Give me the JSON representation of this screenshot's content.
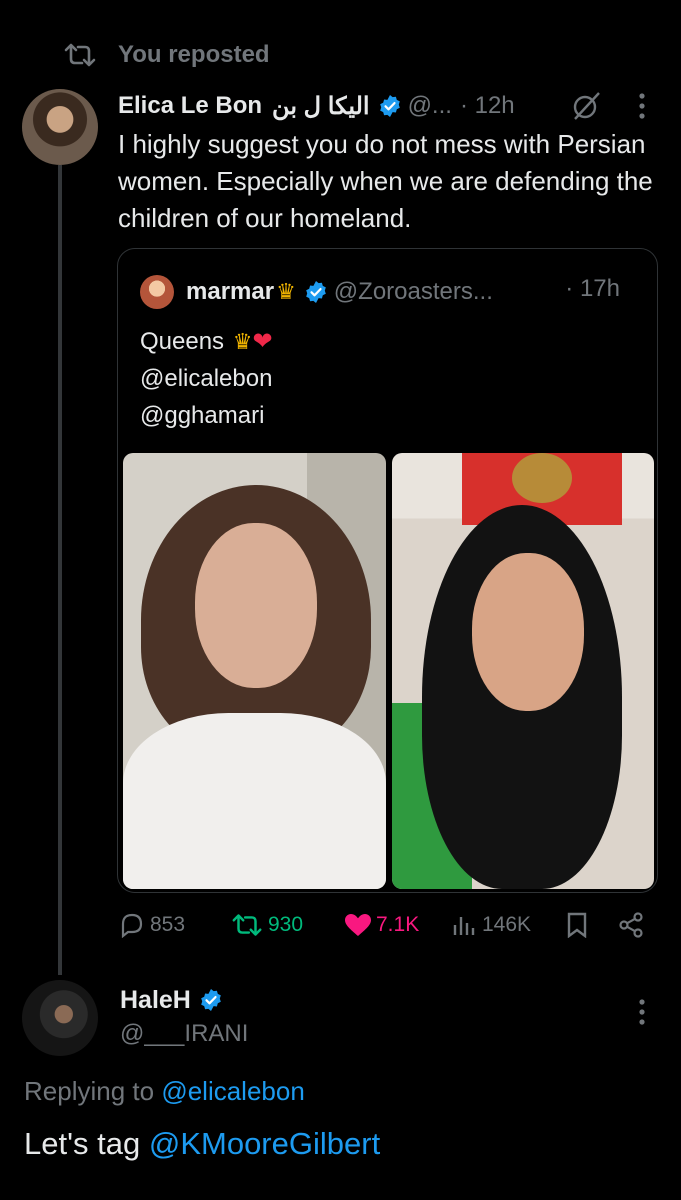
{
  "repost_banner": {
    "label": "You reposted"
  },
  "post": {
    "author_name": "Elica Le Bon",
    "author_name_alt": "الیکا ل بن",
    "handle": "@...",
    "time": "· 12h",
    "text": "I highly suggest you do not mess with Persian women. Especially when we are defending the children of our homeland."
  },
  "quote": {
    "author_name": "marmar",
    "handle": "@Zoroasters...",
    "time": "· 17h",
    "line1": "Queens",
    "line2": "@elicalebon",
    "line3": "@gghamari"
  },
  "actions": {
    "replies": "853",
    "reposts": "930",
    "likes": "7.1K",
    "views": "146K"
  },
  "reply": {
    "author_name": "HaleH",
    "handle": "@___IRANI",
    "replying_prefix": "Replying to",
    "replying_handle": "@elicalebon",
    "text_prefix": "Let's tag",
    "text_mention": "@KMooreGilbert"
  },
  "colors": {
    "background": "#000000",
    "muted": "#71767b",
    "accent": "#1d9bf0",
    "repost_green": "#00ba7c",
    "like_pink": "#f91880"
  }
}
